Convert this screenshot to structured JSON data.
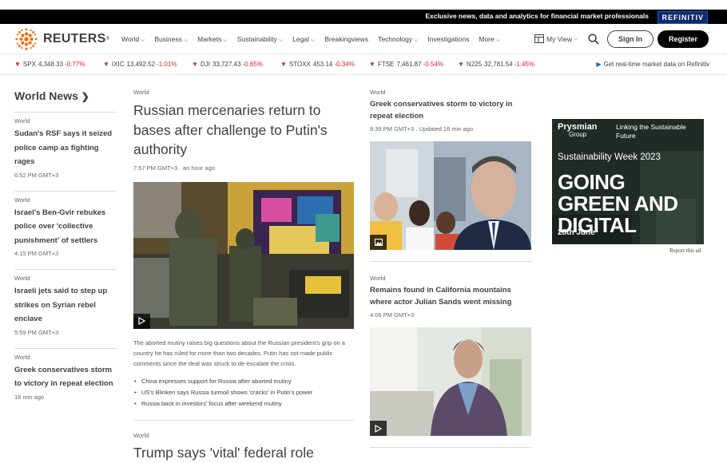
{
  "topbar": {
    "promo": "Exclusive news, data and analytics for financial market professionals",
    "partner": "REFINITIV"
  },
  "nav": {
    "brand": "REUTERS",
    "links": [
      {
        "label": "World",
        "caret": true
      },
      {
        "label": "Business",
        "caret": true
      },
      {
        "label": "Markets",
        "caret": true
      },
      {
        "label": "Sustainability",
        "caret": true
      },
      {
        "label": "Legal",
        "caret": true
      },
      {
        "label": "Breakingviews",
        "caret": false
      },
      {
        "label": "Technology",
        "caret": true
      },
      {
        "label": "Investigations",
        "caret": false
      },
      {
        "label": "More",
        "caret": true
      }
    ],
    "my_view": "My View",
    "sign_in": "Sign In",
    "register": "Register"
  },
  "ticker": {
    "items": [
      {
        "symbol": "SPX",
        "value": "4,348.33",
        "change": "-0.77%"
      },
      {
        "symbol": "IXIC",
        "value": "13,492.52",
        "change": "-1.01%"
      },
      {
        "symbol": "DJI",
        "value": "33,727.43",
        "change": "-0.65%"
      },
      {
        "symbol": "STOXX",
        "value": "453.14",
        "change": "-0.34%"
      },
      {
        "symbol": "FTSE",
        "value": "7,461.87",
        "change": "-0.54%"
      },
      {
        "symbol": "N225",
        "value": "32,781.54",
        "change": "-1.45%"
      }
    ],
    "realtime": "Get real-time market data on Refinitiv"
  },
  "left": {
    "heading": "World News",
    "stories": [
      {
        "kicker": "World",
        "title": "Sudan's RSF says it seized police camp as fighting rages",
        "time": "6:52 PM GMT+3"
      },
      {
        "kicker": "World",
        "title": "Israel's Ben-Gvir rebukes police over 'collective punishment' of settlers",
        "time": "4:15 PM GMT+3"
      },
      {
        "kicker": "World",
        "title": "Israeli jets said to step up strikes on Syrian rebel enclave",
        "time": "5:59 PM GMT+3"
      },
      {
        "kicker": "World",
        "title": "Greek conservatives storm to victory in repeat election",
        "time": "16 min ago"
      }
    ]
  },
  "main": {
    "kicker": "World",
    "headline": "Russian mercenaries return to bases after challenge to Putin's authority",
    "time": "7:57 PM GMT+3 · an hour ago",
    "description": "The aborted mutiny raises big questions about the Russian president's grip on a country he has ruled for more than two decades. Putin has not made public comments since the deal was struck to de-escalate the crisis.",
    "related": [
      "China expresses support for Russia after aborted mutiny",
      "US's Blinken says Russia turmoil shows 'cracks' in Putin's power",
      "Russia back in investors' focus after weekend mutiny"
    ],
    "kicker2": "World",
    "headline2": "Trump says 'vital' federal role"
  },
  "right": {
    "stories": [
      {
        "kicker": "World",
        "title": "Greek conservatives storm to victory in repeat election",
        "time": "8:39 PM GMT+3 . Updated 16 min ago"
      },
      {
        "kicker": "World",
        "title": "Remains found in California mountains where actor Julian Sands went missing",
        "time": "4:06 PM GMT+3"
      }
    ]
  },
  "ad": {
    "brand": "Prysmian",
    "brand_sub": "Group",
    "tagline": "Linking the Sustainable Future",
    "week": "Sustainability Week 2023",
    "headline": "GOING GREEN AND DIGITAL",
    "date": "28th June",
    "report": "Report this ad"
  },
  "colors": {
    "negative": "#d71f1f",
    "accent": "#fa6400",
    "link_blue": "#1f56d6"
  }
}
